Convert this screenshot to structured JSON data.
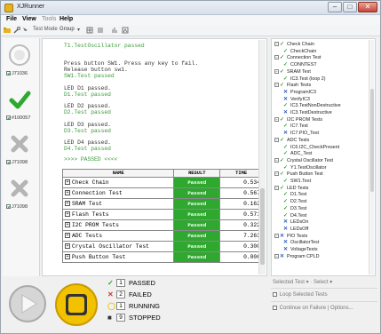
{
  "app": {
    "title": "XJRunner"
  },
  "menu": [
    "File",
    "View",
    "Tools",
    "Help"
  ],
  "toolbar": {
    "mode_label": "Test Mode",
    "mode_value": "Group"
  },
  "left_steps": [
    {
      "state": "pending",
      "label": "J71036",
      "checked": true
    },
    {
      "state": "passed",
      "label": "#100057",
      "checked": true
    },
    {
      "state": "disabled",
      "label": "J71098",
      "checked": true
    },
    {
      "state": "disabled",
      "label": "J71098",
      "checked": true
    }
  ],
  "console": {
    "lines": [
      {
        "text": "T1.TestOscillator passed",
        "color": "green"
      },
      {
        "text": "Press button SW1.  Press any key to fail.",
        "color": "dark"
      },
      {
        "text": "Release button sw1.",
        "color": "dark"
      },
      {
        "text": "SW1.Test passed",
        "color": "green"
      },
      {
        "text": "LED D1 passed.",
        "color": "dark"
      },
      {
        "text": "D1.Test passed",
        "color": "green"
      },
      {
        "text": "LED D2 passed.",
        "color": "dark"
      },
      {
        "text": "D2.Test passed",
        "color": "green"
      },
      {
        "text": "LED D3 passed.",
        "color": "dark"
      },
      {
        "text": "D3.Test passed",
        "color": "green"
      },
      {
        "text": "LED D4 passed.",
        "color": "dark"
      },
      {
        "text": "D4.Test passed",
        "color": "green"
      },
      {
        "text": ">>>> PASSED <<<<",
        "color": "green"
      }
    ],
    "table_headers": [
      "NAME",
      "RESULT",
      "TIME"
    ],
    "results": [
      {
        "name": "Check Chain",
        "result": "Passed",
        "time": "0.534"
      },
      {
        "name": "Connection Test",
        "result": "Passed",
        "time": "0.567"
      },
      {
        "name": "SRAM Test",
        "result": "Passed",
        "time": "0.162"
      },
      {
        "name": "Flash Tests",
        "result": "Passed",
        "time": "0.571"
      },
      {
        "name": "I2C PROM Tests",
        "result": "Passed",
        "time": "0.322"
      },
      {
        "name": "ADC Tests",
        "result": "Passed",
        "time": "7.263"
      },
      {
        "name": "Crystal Oscillator Test",
        "result": "Passed",
        "time": "0.300"
      },
      {
        "name": "Push Button Test",
        "result": "Passed",
        "time": "0.006"
      }
    ]
  },
  "tree": [
    {
      "level": 0,
      "type": "group",
      "status": "ok",
      "label": "Check Chain"
    },
    {
      "level": 1,
      "type": "leaf",
      "status": "ok",
      "label": "CheckChain"
    },
    {
      "level": 0,
      "type": "group",
      "status": "ok",
      "label": "Connection Test"
    },
    {
      "level": 1,
      "type": "leaf",
      "status": "ok",
      "label": "CONNTEST"
    },
    {
      "level": 0,
      "type": "group",
      "status": "ok",
      "label": "SRAM Test"
    },
    {
      "level": 1,
      "type": "leaf",
      "status": "ok",
      "label": "IC3.Test (loop 2)"
    },
    {
      "level": 0,
      "type": "group",
      "status": "ok",
      "label": "Flash Tests"
    },
    {
      "level": 1,
      "type": "leaf",
      "status": "x",
      "label": "ProgramIC3"
    },
    {
      "level": 1,
      "type": "leaf",
      "status": "x",
      "label": "VerifyIC3"
    },
    {
      "level": 1,
      "type": "leaf",
      "status": "ok",
      "label": "IC3.TestNonDestructive"
    },
    {
      "level": 1,
      "type": "leaf",
      "status": "x",
      "label": "IC3.TestDestructive"
    },
    {
      "level": 0,
      "type": "group",
      "status": "ok",
      "label": "I2C PROM Tests"
    },
    {
      "level": 1,
      "type": "leaf",
      "status": "ok",
      "label": "IC7.Test"
    },
    {
      "level": 1,
      "type": "leaf",
      "status": "x",
      "label": "IC7.PIO_Test"
    },
    {
      "level": 0,
      "type": "group",
      "status": "ok",
      "label": "ADC Tests"
    },
    {
      "level": 1,
      "type": "leaf",
      "status": "ok",
      "label": "IC6.I2C_CheckPresent"
    },
    {
      "level": 1,
      "type": "leaf",
      "status": "ok",
      "label": "ADC_Test"
    },
    {
      "level": 0,
      "type": "group",
      "status": "ok",
      "label": "Crystal Oscillator Test"
    },
    {
      "level": 1,
      "type": "leaf",
      "status": "ok",
      "label": "Y1.TestOscillator"
    },
    {
      "level": 0,
      "type": "group",
      "status": "ok",
      "label": "Push Button Test"
    },
    {
      "level": 1,
      "type": "leaf",
      "status": "ok",
      "label": "SW1.Test"
    },
    {
      "level": 0,
      "type": "group",
      "status": "ok",
      "label": "LED Tests"
    },
    {
      "level": 1,
      "type": "leaf",
      "status": "ok",
      "label": "D1.Test"
    },
    {
      "level": 1,
      "type": "leaf",
      "status": "ok",
      "label": "D2.Test"
    },
    {
      "level": 1,
      "type": "leaf",
      "status": "ok",
      "label": "D3.Test"
    },
    {
      "level": 1,
      "type": "leaf",
      "status": "ok",
      "label": "D4.Test"
    },
    {
      "level": 1,
      "type": "leaf",
      "status": "x",
      "label": "LEDsOn"
    },
    {
      "level": 1,
      "type": "leaf",
      "status": "x",
      "label": "LEDsOff"
    },
    {
      "level": 0,
      "type": "group",
      "status": "x",
      "label": "PIO Tests"
    },
    {
      "level": 1,
      "type": "leaf",
      "status": "x",
      "label": "OscillatorTest"
    },
    {
      "level": 1,
      "type": "leaf",
      "status": "x",
      "label": "VoltageTests"
    },
    {
      "level": 0,
      "type": "group",
      "status": "x",
      "label": "Program CPLD"
    }
  ],
  "summary": {
    "passed": {
      "count": "1",
      "label": "PASSED"
    },
    "failed": {
      "count": "2",
      "label": "FAILED"
    },
    "running": {
      "count": "1",
      "label": "RUNNING"
    },
    "stopped": {
      "count": "9",
      "label": "STOPPED"
    }
  },
  "rpanel": {
    "selected_test": "Selected Test",
    "select": "Select",
    "loop_label": "Loop Selected Tests",
    "continue_label": "Continue on Failure",
    "options_label": "Options..."
  },
  "colors": {
    "pass_green": "#2fa82f",
    "fail_red": "#d23b2a",
    "running_yellow": "#f2c200",
    "accent_blue": "#2b5fbf"
  }
}
